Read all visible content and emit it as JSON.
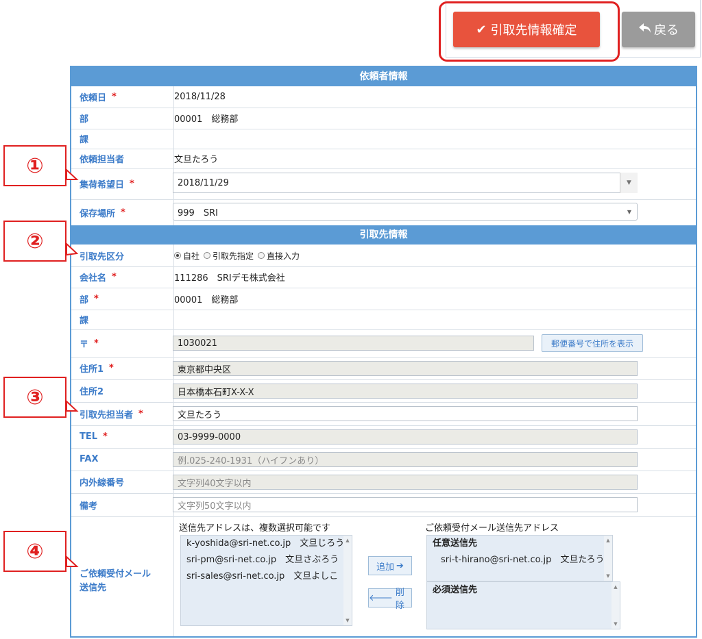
{
  "toolbar": {
    "confirm_label": "引取先情報確定",
    "back_label": "戻る"
  },
  "requester_section": {
    "title": "依頼者情報",
    "rows": [
      {
        "label": "依頼日",
        "required": "*",
        "value": "2018/11/28"
      },
      {
        "label": "部",
        "required": "",
        "value": "00001　総務部"
      },
      {
        "label": "課",
        "required": "",
        "value": ""
      },
      {
        "label": "依頼担当者",
        "required": "",
        "value": "文旦たろう"
      },
      {
        "label": "集荷希望日",
        "required": "*",
        "value": "2018/11/29"
      },
      {
        "label": "保存場所",
        "required": "*",
        "value": "999　SRI"
      }
    ]
  },
  "pickup_section": {
    "title": "引取先情報",
    "type_label": "引取先区分",
    "type_options": [
      "自社",
      "引取先指定",
      "直接入力"
    ],
    "type_selected": "自社",
    "company": {
      "label": "会社名",
      "required": "*",
      "value": "111286　SRIデモ株式会社"
    },
    "dept": {
      "label": "部",
      "required": "*",
      "value": "00001　総務部"
    },
    "section": {
      "label": "課",
      "required": "",
      "value": ""
    },
    "zip": {
      "label": "〒",
      "required": "*",
      "value": "1030021",
      "button": "郵便番号で住所を表示"
    },
    "address1": {
      "label": "住所1",
      "required": "*",
      "value": "東京都中央区"
    },
    "address2": {
      "label": "住所2",
      "required": "",
      "value": "日本橋本石町X-X-X"
    },
    "contact": {
      "label": "引取先担当者",
      "required": "*",
      "value": "文旦たろう"
    },
    "tel": {
      "label": "TEL",
      "required": "*",
      "value": "03-9999-0000"
    },
    "fax": {
      "label": "FAX",
      "required": "",
      "placeholder": "例.025-240-1931（ハイフンあり）"
    },
    "ext": {
      "label": "内外線番号",
      "required": "",
      "placeholder": "文字列40文字以内"
    },
    "memo": {
      "label": "備考",
      "required": "",
      "placeholder": "文字列50文字以内"
    }
  },
  "mail_section": {
    "label": "ご依頼受付メール送信先",
    "left_caption": "送信先アドレスは、複数選択可能です",
    "candidates": [
      "k-yoshida@sri-net.co.jp　文旦じろう",
      "sri-pm@sri-net.co.jp　文旦さぶろう",
      "sri-sales@sri-net.co.jp　文旦よしこ"
    ],
    "add_label": "追加",
    "delete_label": "削除",
    "right_caption": "ご依頼受付メール送信先アドレス",
    "optional_title": "任意送信先",
    "optional_items": [
      "sri-t-hirano@sri-net.co.jp　文旦たろう"
    ],
    "required_title": "必須送信先"
  },
  "callouts": [
    "①",
    "②",
    "③",
    "④"
  ],
  "colors": {
    "accent": "#5b9bd5",
    "confirm": "#e8533d",
    "back": "#9b9b9b",
    "highlight": "#e02020",
    "label": "#3d7cc9"
  }
}
